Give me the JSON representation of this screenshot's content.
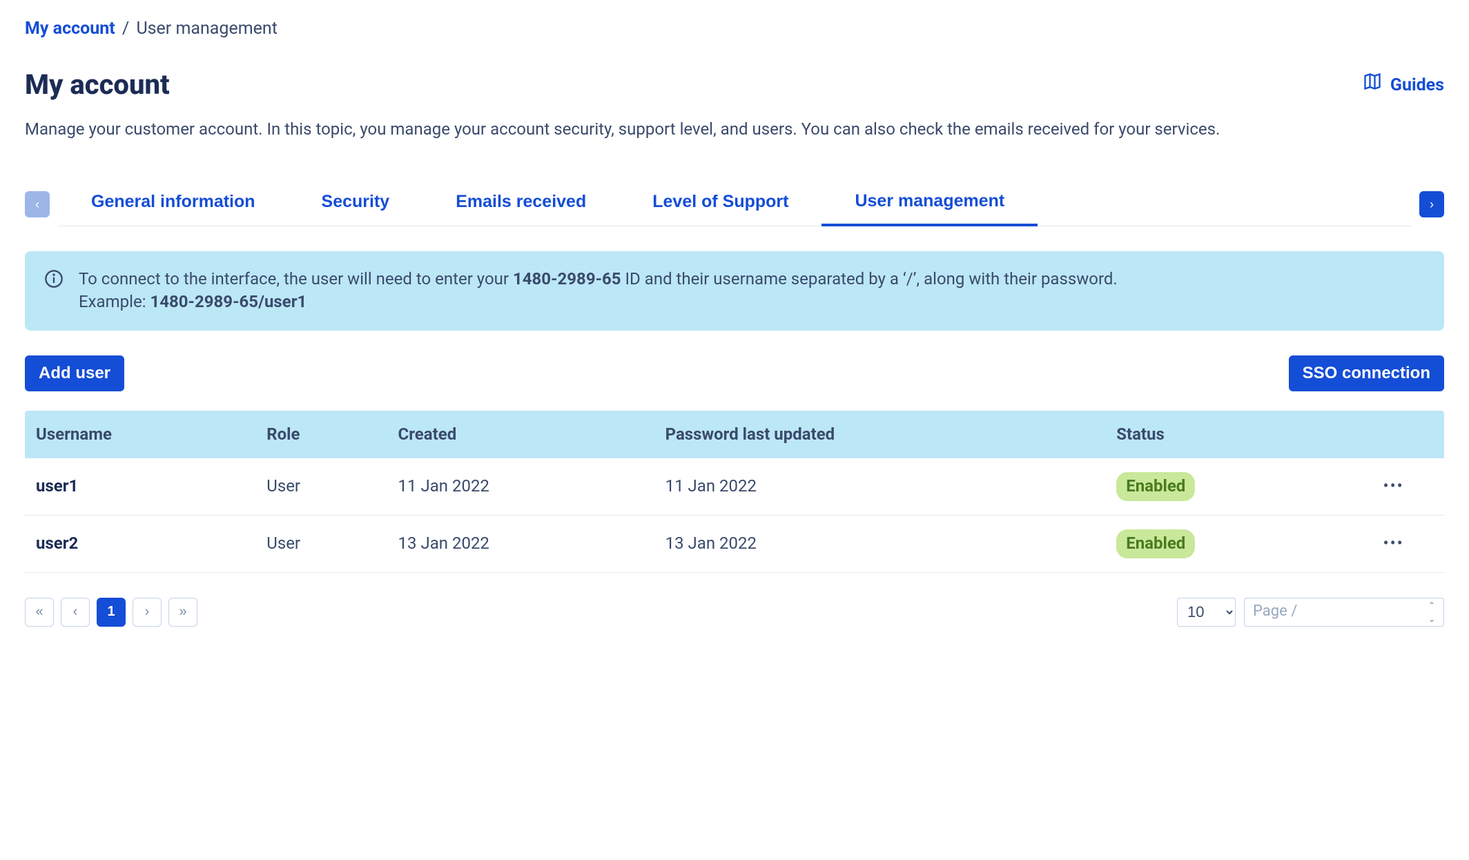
{
  "breadcrumb": {
    "root": "My account",
    "current": "User management",
    "sep": "/"
  },
  "header": {
    "title": "My account",
    "guides_label": "Guides",
    "description": "Manage your customer account. In this topic, you manage your account security, support level, and users. You can also check the emails received for your services."
  },
  "tabs": {
    "items": [
      {
        "label": "General information"
      },
      {
        "label": "Security"
      },
      {
        "label": "Emails received"
      },
      {
        "label": "Level of Support"
      },
      {
        "label": "User management"
      }
    ],
    "active_index": 4
  },
  "info": {
    "line1_before": "To connect to the interface, the user will need to enter your ",
    "account_id": "1480-2989-65",
    "line1_after": " ID and their username separated by a ‘/’, along with their password.",
    "example_label": "Example: ",
    "example_value": "1480-2989-65/user1"
  },
  "actions": {
    "add_user": "Add user",
    "sso": "SSO connection"
  },
  "table": {
    "columns": {
      "username": "Username",
      "role": "Role",
      "created": "Created",
      "pwd": "Password last updated",
      "status": "Status"
    },
    "rows": [
      {
        "username": "user1",
        "role": "User",
        "created": "11 Jan 2022",
        "pwd": "11 Jan 2022",
        "status": "Enabled"
      },
      {
        "username": "user2",
        "role": "User",
        "created": "13 Jan 2022",
        "pwd": "13 Jan 2022",
        "status": "Enabled"
      }
    ]
  },
  "pagination": {
    "first": "«",
    "prev": "‹",
    "page": "1",
    "next": "›",
    "last": "»",
    "page_size": "10",
    "page_input_placeholder": "Page  /"
  }
}
